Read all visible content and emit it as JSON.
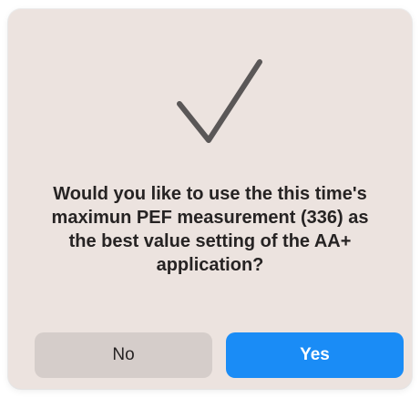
{
  "dialog": {
    "icon": "checkmark-icon",
    "message": "Would you like to use the this time's maximun PEF measurement (336) as the best value setting of the AA+ application?",
    "no_label": "No",
    "yes_label": "Yes"
  },
  "colors": {
    "dialog_background": "#ece3df",
    "checkmark": "#5a5757",
    "no_button": "#d5cdca",
    "yes_button": "#1a8cf6",
    "text": "#262323"
  }
}
